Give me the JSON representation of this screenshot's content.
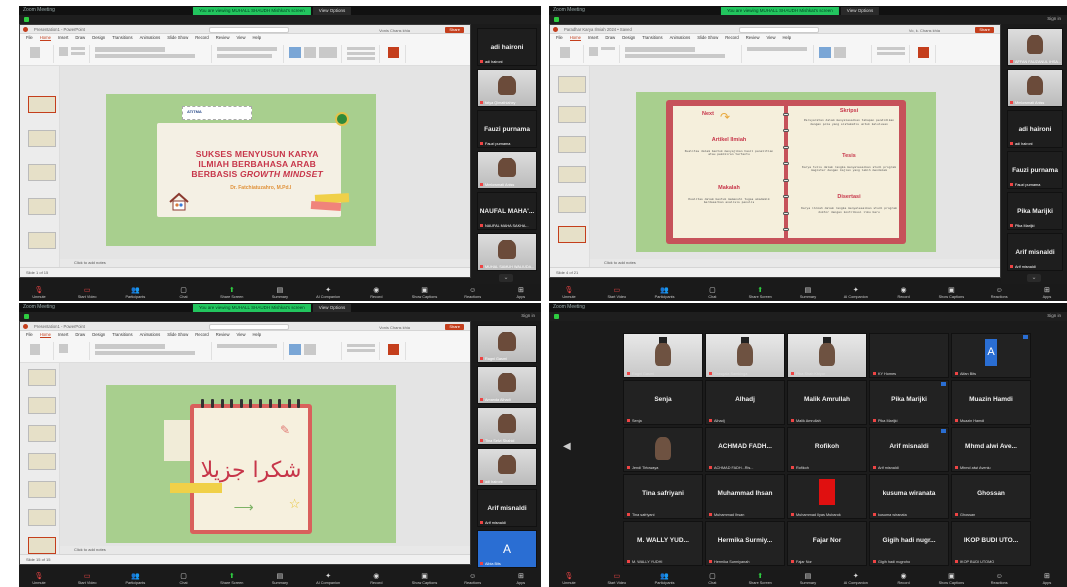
{
  "common": {
    "zoom_window_title": "Zoom Meeting",
    "viewing_banner": "You are viewing MUHALL SHAUDH Mishkat's screen",
    "view_options": "View Options",
    "signin": "Sign in",
    "notes_prompt": "Click to add notes",
    "pp_search": "Search",
    "pp_share": "Share",
    "toolbar": [
      {
        "label": "Unmute",
        "icon": "mic-off-icon"
      },
      {
        "label": "Start Video",
        "icon": "video-off-icon"
      },
      {
        "label": "Participants",
        "icon": "participants-icon"
      },
      {
        "label": "Chat",
        "icon": "chat-icon"
      },
      {
        "label": "Share Screen",
        "icon": "share-screen-icon"
      },
      {
        "label": "Summary",
        "icon": "summary-icon"
      },
      {
        "label": "AI Companion",
        "icon": "ai-companion-icon"
      },
      {
        "label": "Record",
        "icon": "record-icon"
      },
      {
        "label": "Show Captions",
        "icon": "captions-icon"
      },
      {
        "label": "Reactions",
        "icon": "reactions-icon"
      },
      {
        "label": "Apps",
        "icon": "apps-icon"
      }
    ],
    "menu": [
      "File",
      "Home",
      "Insert",
      "Draw",
      "Design",
      "Transitions",
      "Animations",
      "Slide Show",
      "Record",
      "Review",
      "View",
      "Help"
    ]
  },
  "window1": {
    "pp_title": "Presentation1 - PowerPoint",
    "presenter": "Vonis Chans khia",
    "slide": {
      "brand": "ATITMA",
      "title_line1": "SUKSES MENYUSUN KARYA",
      "title_line2": "ILMIAH BERBAHASA ARAB",
      "title_line3_prefix": "BERBASIS",
      "title_line3_em": "GROWTH MINDSET",
      "author": "Dr. Fatchiatuzahro, M.Pd.I",
      "house_caption": "Pengabdian"
    },
    "status_left": "Slide 1 of 15",
    "panel": [
      {
        "type": "name",
        "name": "adi haironi",
        "label": "adi haironi"
      },
      {
        "type": "video",
        "label": "fatya Qimathiahxy"
      },
      {
        "type": "name",
        "name": "Fauzi purnama",
        "label": "Fauzi purnama"
      },
      {
        "type": "video",
        "label": "Mmlowmati Aniss"
      },
      {
        "type": "name",
        "name": "NAUFAL MAHA'...",
        "label": "NAUFAL MAHA SAKHA..."
      },
      {
        "type": "video",
        "label": "MUHAL SAMUH WALIUDA..."
      }
    ]
  },
  "window2": {
    "pp_title": "Paradhar Karya Ilmiah 2024 • Saved",
    "presenter": "Vo, k. Chans khia",
    "slide": {
      "next": "Next",
      "artikel": "Artikel Ilmiah",
      "artikel_text": "Kualitas dalam bentuk menyajikan hasil penelitian atau pemikiran tertentu",
      "makalah": "Makalah",
      "makalah_text": "Kualitas dalam bentuk memenuhi tugas akademik berdasarkan analisis penulis",
      "skripsi": "Skripsi",
      "skripsi_text": "Persyaratan dalam menyelesaikan tahapan pendidikan dengan pola yang sistematis untuk kelulusan",
      "tesis": "Tesis",
      "tesis_text": "Karya tulis dalam rangka menyelesaikan studi program magister dengan kajian yang lebih mendalam",
      "disertasi": "Disertasi",
      "disertasi_text": "Karya ilmiah dalam rangka menyelesaikan studi program doktor dengan kontribusi ilmu baru"
    },
    "status_left": "Slide 4 of 21",
    "panel": [
      {
        "type": "video",
        "label": "AFFAN FAUZANUL IHSA..."
      },
      {
        "type": "video",
        "label": "Mmlowmati Aniss"
      },
      {
        "type": "name",
        "name": "adi haironi",
        "label": "adi haironi"
      },
      {
        "type": "name",
        "name": "Fauzi purnama",
        "label": "Fauzi purnama"
      },
      {
        "type": "name",
        "name": "Pika Marijki",
        "label": "Pika Marijki"
      },
      {
        "type": "name",
        "name": "Arif misnaldi",
        "label": "Arif misnaldi"
      }
    ]
  },
  "window3": {
    "pp_title": "Presentation1 - PowerPoint",
    "presenter": "Vonis Chans khia",
    "slide": {
      "arabic": "شكرا جزيلا"
    },
    "status_left": "Slide 15 of 15",
    "panel": [
      {
        "type": "video",
        "label": "Ragni Gasmi"
      },
      {
        "type": "video",
        "label": "Amanda Alhadi"
      },
      {
        "type": "video",
        "label": "Tina Selvi Shahid"
      },
      {
        "type": "video",
        "label": "adi haironi"
      },
      {
        "type": "name",
        "name": "Arif misnaldi",
        "label": "Arif misnaldi"
      },
      {
        "type": "blue",
        "name": "A",
        "label": "Albia Bits"
      }
    ]
  },
  "window4": {
    "tiles": [
      {
        "kind": "video",
        "label": "Ragni Gasmi"
      },
      {
        "kind": "video",
        "label": "Grasgala Samkinga"
      },
      {
        "kind": "video",
        "label": "Pika Shah Khiyar"
      },
      {
        "kind": "dark",
        "label": "KY Homes"
      },
      {
        "kind": "avatar",
        "avatar": "A",
        "label": "Alfan Bits"
      },
      {
        "kind": "name",
        "name": "Senja",
        "label": "Senja"
      },
      {
        "kind": "name",
        "name": "Alhadj",
        "label": "Alhadj"
      },
      {
        "kind": "name",
        "name": "Malik Amrullah",
        "label": "Malik Amrullah"
      },
      {
        "kind": "name",
        "name": "Pika Marijki",
        "label": "Pika Marijki"
      },
      {
        "kind": "name",
        "name": "Muazin Hamdi",
        "label": "Muazin Hamdi"
      },
      {
        "kind": "face",
        "label": "Jendi Tirtowaya"
      },
      {
        "kind": "name",
        "name": "ACHMAD FADH...",
        "label": "ACHMAD FADH...Ris..."
      },
      {
        "kind": "name",
        "name": "Rofikoh",
        "label": "Rofikoh"
      },
      {
        "kind": "name",
        "name": "Arif misnaldi",
        "label": "Arif misnaldi"
      },
      {
        "kind": "name",
        "name": "Mhmd alwi Ave...",
        "label": "Mhmd alwi Aveniu"
      },
      {
        "kind": "name",
        "name": "Tina safriyani",
        "label": "Tina safriyani"
      },
      {
        "kind": "name",
        "name": "Muhammad Ihsan",
        "label": "Muhammad Ihsan"
      },
      {
        "kind": "red",
        "label": "Muhammad Ilyas Mubarok"
      },
      {
        "kind": "name",
        "name": "kusuma wiranata",
        "label": "kusuma wiranata"
      },
      {
        "kind": "name",
        "name": "Ghossan",
        "label": "Ghossan"
      },
      {
        "kind": "name",
        "name": "M. WALLY YUD...",
        "label": "M. WALLY YUDHI"
      },
      {
        "kind": "name",
        "name": "Hermika Surmiy...",
        "label": "Hermika Surmiyanah"
      },
      {
        "kind": "name",
        "name": "Fajar Nor",
        "label": "Fajar Nor"
      },
      {
        "kind": "name",
        "name": "Gigih hadi nugr...",
        "label": "Gigih hadi nugroho"
      },
      {
        "kind": "name",
        "name": "IKOP BUDI UTO...",
        "label": "IKOP BUDI UTOMO"
      }
    ]
  }
}
